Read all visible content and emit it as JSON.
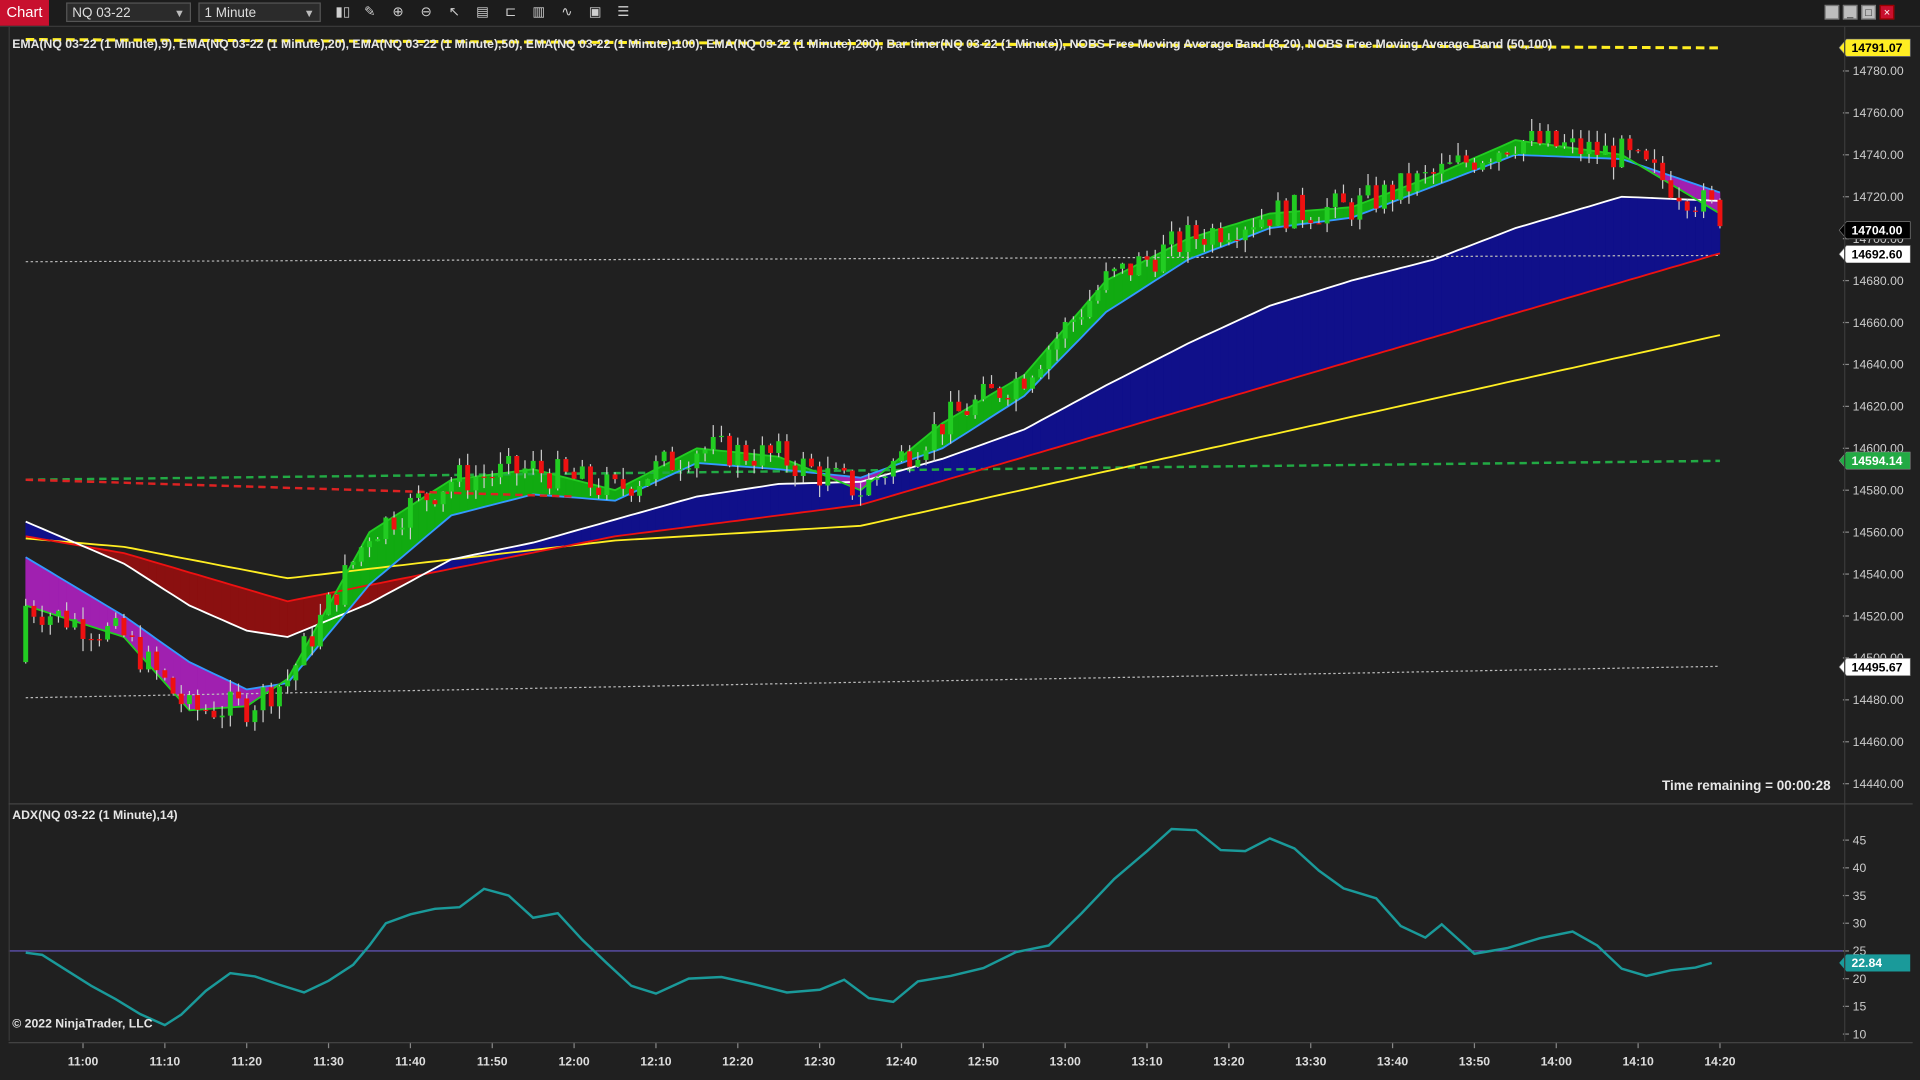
{
  "toolbar": {
    "tab_label": "Chart",
    "instrument": "NQ 03-22",
    "interval": "1 Minute",
    "tools": [
      "bar-type-icon",
      "draw-icon",
      "zoom-in-icon",
      "zoom-out-icon",
      "pointer-icon",
      "data-box-icon",
      "properties-icon",
      "strategies-icon",
      "indicators-icon",
      "templates-icon"
    ],
    "window_buttons": [
      "restore-icon",
      "minimize-icon",
      "maximize-icon",
      "close-icon"
    ]
  },
  "indicator_label": "EMA(NQ 03-22 (1 Minute),9), EMA(NQ 03-22 (1 Minute),20), EMA(NQ 03-22 (1 Minute),50), EMA(NQ 03-22 (1 Minute),100), EMA(NQ 03-22 (1 Minute),200), Bar timer(NQ 03-22 (1 Minute)), NOBS Free Moving Average Band (8,20), NOBS Free Moving Average Band (50,100)",
  "adx_label": "ADX(NQ 03-22 (1 Minute),14)",
  "timer_text": "Time remaining = 00:00:28",
  "copyright": "© 2022 NinjaTrader, LLC",
  "colors": {
    "background": "#202020",
    "bull": "#22cc22",
    "bear": "#ee1111",
    "ema9": "#22cc22",
    "ema20": "#3399ff",
    "ema50": "#ffffff",
    "ema100": "#ee1111",
    "ema200": "#ffee22",
    "band_fast_up": "#11aa11",
    "band_fast_down": "#a020b0",
    "band_slow_up": "#10108a",
    "band_slow_down": "#8b1010",
    "adx": "#1a9a9a",
    "adx_ref": "#6a5acd"
  },
  "chart_data": [
    {
      "type": "candlestick",
      "title": "",
      "x_ticks": [
        "11:00",
        "11:10",
        "11:20",
        "11:30",
        "11:40",
        "11:50",
        "12:00",
        "12:10",
        "12:20",
        "12:30",
        "12:40",
        "12:50",
        "13:00",
        "13:10",
        "13:20",
        "13:30",
        "13:40",
        "13:50",
        "14:00",
        "14:10",
        "14:20"
      ],
      "x_range": [
        "10:53",
        "14:22"
      ],
      "y_ticks": [
        14440,
        14460,
        14480,
        14500,
        14520,
        14540,
        14560,
        14580,
        14600,
        14620,
        14640,
        14660,
        14680,
        14700,
        14720,
        14740,
        14760,
        14780
      ],
      "ylim": [
        14433,
        14801
      ],
      "price_flags": [
        {
          "label": "14791.07",
          "value": 14791.07,
          "color": "#ffee22",
          "text_color": "#000000"
        },
        {
          "label": "14704.00",
          "value": 14704.0,
          "color": "#000000",
          "text_color": "#ffffff"
        },
        {
          "label": "14692.60",
          "value": 14692.6,
          "color": "#ffffff",
          "text_color": "#000000"
        },
        {
          "label": "14594.14",
          "value": 14594.14,
          "color": "#22aa44",
          "text_color": "#ffffff"
        },
        {
          "label": "14495.67",
          "value": 14495.67,
          "color": "#ffffff",
          "text_color": "#000000"
        }
      ],
      "series_keys": [
        {
          "time": "10:53",
          "ema9": 14525,
          "ema20": 14548,
          "ema50": 14565,
          "ema100": 14558,
          "ema200": 14557,
          "upper": 14689,
          "middle": 14585,
          "lower": 14481,
          "long": 14795
        },
        {
          "time": "11:05",
          "ema9": 14510,
          "ema20": 14520,
          "ema50": 14545,
          "ema100": 14550,
          "ema200": 14553
        },
        {
          "time": "11:13",
          "ema9": 14475,
          "ema20": 14498,
          "ema50": 14525
        },
        {
          "time": "11:20",
          "ema9": 14477,
          "ema20": 14485,
          "ema50": 14513
        },
        {
          "time": "11:25",
          "ema9": 14490,
          "ema20": 14488,
          "ema50": 14510,
          "ema100": 14527,
          "ema200": 14538
        },
        {
          "time": "11:35",
          "ema9": 14560,
          "ema20": 14535,
          "ema50": 14526
        },
        {
          "time": "11:45",
          "ema9": 14585,
          "ema20": 14568,
          "ema50": 14547
        },
        {
          "time": "11:55",
          "ema9": 14590,
          "ema20": 14578,
          "ema50": 14555
        },
        {
          "time": "12:05",
          "ema9": 14580,
          "ema20": 14575,
          "ema50": 14566,
          "ema100": 14558,
          "ema200": 14556
        },
        {
          "time": "12:15",
          "ema9": 14600,
          "ema20": 14593,
          "ema50": 14577
        },
        {
          "time": "12:25",
          "ema9": 14596,
          "ema20": 14590,
          "ema50": 14583
        },
        {
          "time": "12:35",
          "ema9": 14580,
          "ema20": 14586,
          "ema50": 14584,
          "ema100": 14573,
          "ema200": 14563
        },
        {
          "time": "12:45",
          "ema9": 14612,
          "ema20": 14600,
          "ema50": 14595
        },
        {
          "time": "12:55",
          "ema9": 14635,
          "ema20": 14625,
          "ema50": 14609
        },
        {
          "time": "13:05",
          "ema9": 14680,
          "ema20": 14665,
          "ema50": 14630
        },
        {
          "time": "13:15",
          "ema9": 14700,
          "ema20": 14690,
          "ema50": 14650
        },
        {
          "time": "13:25",
          "ema9": 14712,
          "ema20": 14705,
          "ema50": 14668
        },
        {
          "time": "13:35",
          "ema9": 14715,
          "ema20": 14710,
          "ema50": 14680
        },
        {
          "time": "13:45",
          "ema9": 14730,
          "ema20": 14725,
          "ema50": 14690
        },
        {
          "time": "13:55",
          "ema9": 14747,
          "ema20": 14740,
          "ema50": 14705
        },
        {
          "time": "14:08",
          "ema9": 14740,
          "ema20": 14738,
          "ema50": 14720
        },
        {
          "time": "14:20",
          "ema9": 14712,
          "ema20": 14722,
          "ema50": 14718,
          "ema100": 14693,
          "ema200": 14654,
          "upper": 14692,
          "middle": 14594,
          "lower": 14496,
          "long": 14791
        }
      ],
      "open_range": [
        14478,
        14752
      ],
      "close_price": 14704.0
    },
    {
      "type": "line",
      "title": "",
      "x_ticks": [
        "11:00",
        "11:10",
        "11:20",
        "11:30",
        "11:40",
        "11:50",
        "12:00",
        "12:10",
        "12:20",
        "12:30",
        "12:40",
        "12:50",
        "13:00",
        "13:10",
        "13:20",
        "13:30",
        "13:40",
        "13:50",
        "14:00",
        "14:10",
        "14:20"
      ],
      "y_ticks": [
        10,
        15,
        20,
        25,
        30,
        35,
        40,
        45
      ],
      "ylim": [
        9,
        49
      ],
      "reference_level": 25,
      "current_label": "22.84",
      "series": [
        {
          "name": "ADX",
          "values": [
            {
              "time": "10:53",
              "v": 24.7
            },
            {
              "time": "10:55",
              "v": 24.3
            },
            {
              "time": "10:58",
              "v": 21.5
            },
            {
              "time": "11:01",
              "v": 18.7
            },
            {
              "time": "11:04",
              "v": 16.3
            },
            {
              "time": "11:07",
              "v": 13.6
            },
            {
              "time": "11:10",
              "v": 11.6
            },
            {
              "time": "11:12",
              "v": 13.5
            },
            {
              "time": "11:15",
              "v": 17.8
            },
            {
              "time": "11:18",
              "v": 21.0
            },
            {
              "time": "11:21",
              "v": 20.4
            },
            {
              "time": "11:24",
              "v": 18.9
            },
            {
              "time": "11:27",
              "v": 17.5
            },
            {
              "time": "11:30",
              "v": 19.6
            },
            {
              "time": "11:33",
              "v": 22.5
            },
            {
              "time": "11:35",
              "v": 26.0
            },
            {
              "time": "11:37",
              "v": 30.0
            },
            {
              "time": "11:40",
              "v": 31.6
            },
            {
              "time": "11:43",
              "v": 32.6
            },
            {
              "time": "11:46",
              "v": 32.9
            },
            {
              "time": "11:49",
              "v": 36.2
            },
            {
              "time": "11:52",
              "v": 35.0
            },
            {
              "time": "11:55",
              "v": 31.0
            },
            {
              "time": "11:58",
              "v": 31.8
            },
            {
              "time": "12:01",
              "v": 27.0
            },
            {
              "time": "12:04",
              "v": 22.8
            },
            {
              "time": "12:07",
              "v": 18.7
            },
            {
              "time": "12:10",
              "v": 17.3
            },
            {
              "time": "12:14",
              "v": 20.0
            },
            {
              "time": "12:18",
              "v": 20.3
            },
            {
              "time": "12:22",
              "v": 19.0
            },
            {
              "time": "12:26",
              "v": 17.5
            },
            {
              "time": "12:30",
              "v": 18.0
            },
            {
              "time": "12:33",
              "v": 19.8
            },
            {
              "time": "12:36",
              "v": 16.5
            },
            {
              "time": "12:39",
              "v": 15.8
            },
            {
              "time": "12:42",
              "v": 19.5
            },
            {
              "time": "12:46",
              "v": 20.5
            },
            {
              "time": "12:50",
              "v": 21.9
            },
            {
              "time": "12:54",
              "v": 24.8
            },
            {
              "time": "12:58",
              "v": 26.0
            },
            {
              "time": "13:02",
              "v": 31.8
            },
            {
              "time": "13:06",
              "v": 38.0
            },
            {
              "time": "13:10",
              "v": 43.0
            },
            {
              "time": "13:13",
              "v": 47.0
            },
            {
              "time": "13:16",
              "v": 46.8
            },
            {
              "time": "13:19",
              "v": 43.2
            },
            {
              "time": "13:22",
              "v": 43.0
            },
            {
              "time": "13:25",
              "v": 45.3
            },
            {
              "time": "13:28",
              "v": 43.5
            },
            {
              "time": "13:31",
              "v": 39.5
            },
            {
              "time": "13:34",
              "v": 36.3
            },
            {
              "time": "13:38",
              "v": 34.5
            },
            {
              "time": "13:41",
              "v": 29.5
            },
            {
              "time": "13:44",
              "v": 27.4
            },
            {
              "time": "13:46",
              "v": 29.8
            },
            {
              "time": "13:50",
              "v": 24.5
            },
            {
              "time": "13:54",
              "v": 25.5
            },
            {
              "time": "13:58",
              "v": 27.3
            },
            {
              "time": "14:02",
              "v": 28.5
            },
            {
              "time": "14:05",
              "v": 26.0
            },
            {
              "time": "14:08",
              "v": 21.8
            },
            {
              "time": "14:11",
              "v": 20.5
            },
            {
              "time": "14:14",
              "v": 21.5
            },
            {
              "time": "14:17",
              "v": 22.0
            },
            {
              "time": "14:19",
              "v": 22.84
            }
          ]
        }
      ]
    }
  ]
}
